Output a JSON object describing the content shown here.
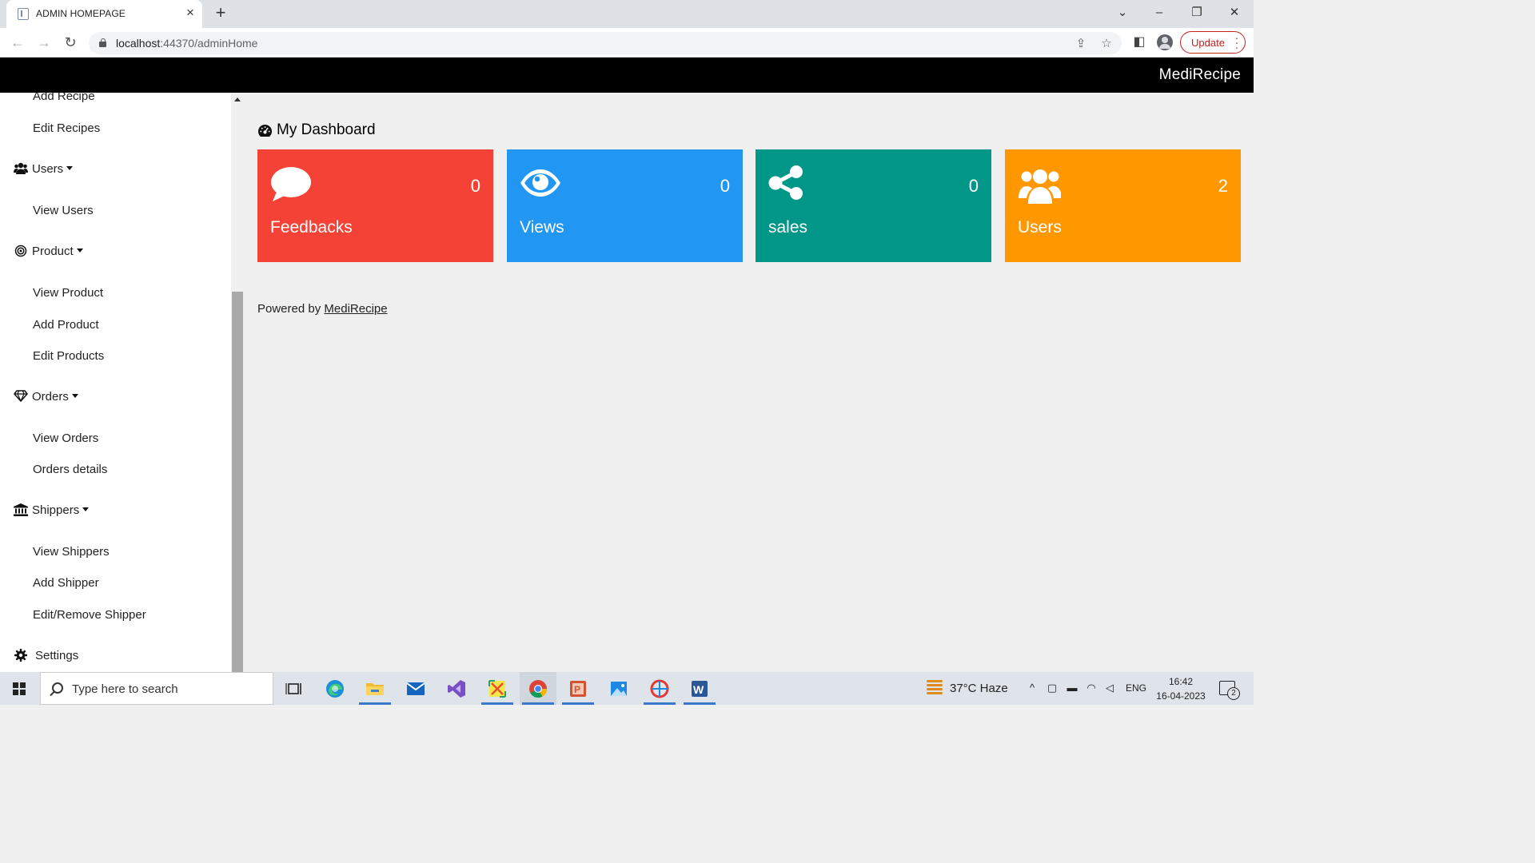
{
  "browser": {
    "tab_title": "ADMIN HOMEPAGE",
    "url_host": "localhost",
    "url_path": ":44370/adminHome",
    "update_label": "Update"
  },
  "header": {
    "brand": "MediRecipe"
  },
  "sidebar": {
    "items_top": [
      {
        "label": "Add Recipe"
      },
      {
        "label": "Edit Recipes"
      }
    ],
    "groups": [
      {
        "label": "Users",
        "icon": "users-icon",
        "items": [
          {
            "label": "View Users"
          }
        ]
      },
      {
        "label": "Product",
        "icon": "bullseye-icon",
        "items": [
          {
            "label": "View Product"
          },
          {
            "label": "Add Product"
          },
          {
            "label": "Edit Products"
          }
        ]
      },
      {
        "label": "Orders",
        "icon": "diamond-icon",
        "items": [
          {
            "label": "View Orders"
          },
          {
            "label": "Orders details"
          }
        ]
      },
      {
        "label": "Shippers",
        "icon": "bank-icon",
        "items": [
          {
            "label": "View Shippers"
          },
          {
            "label": "Add Shipper"
          },
          {
            "label": "Edit/Remove Shipper"
          }
        ]
      }
    ],
    "settings": {
      "label": "Settings",
      "icon": "gear-icon"
    }
  },
  "main": {
    "title": "My Dashboard",
    "cards": [
      {
        "label": "Feedbacks",
        "count": "0",
        "color": "#f44336",
        "icon": "comment-icon"
      },
      {
        "label": "Views",
        "count": "0",
        "color": "#2196f3",
        "icon": "eye-icon"
      },
      {
        "label": "sales",
        "count": "0",
        "color": "#009688",
        "icon": "share-icon"
      },
      {
        "label": "Users",
        "count": "2",
        "color": "#ff9800",
        "icon": "users-icon"
      }
    ],
    "footer_prefix": "Powered by ",
    "footer_link": "MediRecipe"
  },
  "taskbar": {
    "search_placeholder": "Type here to search",
    "weather": "37°C  Haze",
    "language": "ENG",
    "time": "16:42",
    "date": "16-04-2023",
    "notification_count": "2"
  }
}
